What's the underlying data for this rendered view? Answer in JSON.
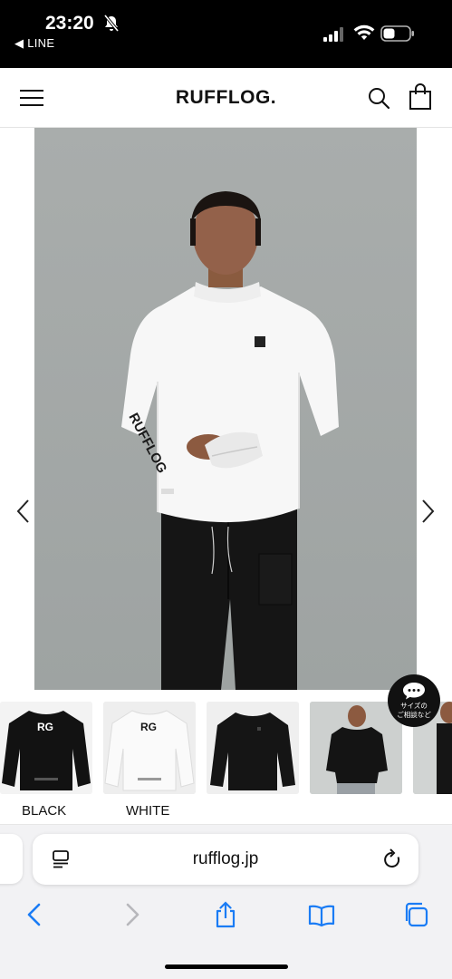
{
  "status_bar": {
    "time": "23:20",
    "back_app": "◀ LINE",
    "icons": [
      "bell-off-icon",
      "signal-icon",
      "wifi-icon",
      "battery-icon"
    ]
  },
  "header": {
    "logo": "RUFFLOG.",
    "icons": [
      "menu-icon",
      "search-icon",
      "shopping-bag-icon"
    ]
  },
  "hero": {
    "sleeve_print": "RUFFLOG",
    "nav": [
      "chevron-left-icon",
      "chevron-right-icon"
    ]
  },
  "consult_button": {
    "label_line1": "サイズの",
    "label_line2": "ご相談など",
    "icon": "chat-bubble-icon"
  },
  "colors_variants": [
    {
      "label": "BLACK",
      "print": "RG"
    },
    {
      "label": "WHITE",
      "print": "RG"
    },
    {
      "label": ""
    },
    {
      "label": ""
    }
  ],
  "browser": {
    "url": "rufflog.jp",
    "toolbar": [
      "back-icon",
      "forward-icon",
      "share-icon",
      "bookmarks-icon",
      "tabs-icon"
    ]
  },
  "palette": {
    "hero_bg": "#a7abaa",
    "safari_blue": "#1a7cf5",
    "status_bg": "#000000"
  }
}
